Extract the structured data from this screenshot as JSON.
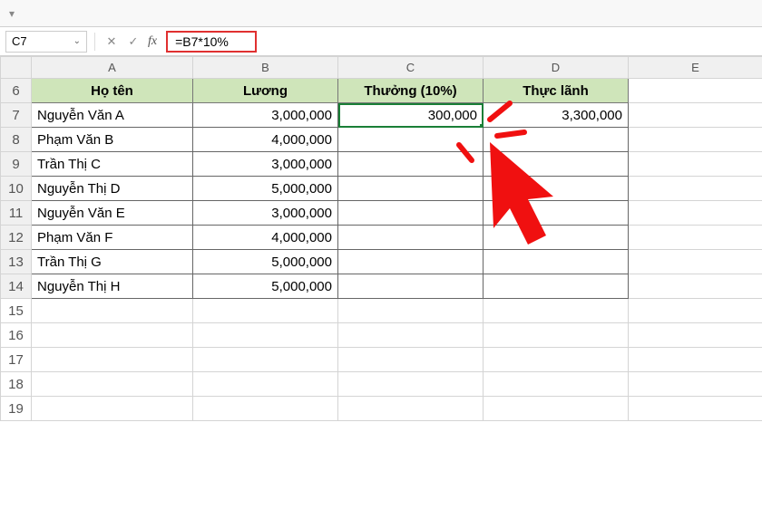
{
  "ribbon": {
    "dropdown_glyph": "▾"
  },
  "namebox": {
    "value": "C7",
    "chevron": "⌄"
  },
  "fx": {
    "cancel": "✕",
    "confirm": "✓",
    "label": "fx"
  },
  "formula": {
    "text": "=B7*10%"
  },
  "col_headers": [
    "A",
    "B",
    "C",
    "D",
    "E"
  ],
  "row_numbers": [
    "6",
    "7",
    "8",
    "9",
    "10",
    "11",
    "12",
    "13",
    "14",
    "15",
    "16",
    "17",
    "18",
    "19"
  ],
  "headers": {
    "name": "Họ tên",
    "salary": "Lương",
    "bonus": "Thưởng (10%)",
    "net": "Thực lãnh"
  },
  "rows": [
    {
      "name": "Nguyễn Văn A",
      "salary": "3,000,000",
      "bonus": "300,000",
      "net": "3,300,000"
    },
    {
      "name": "Phạm Văn B",
      "salary": "4,000,000",
      "bonus": "",
      "net": ""
    },
    {
      "name": "Trần Thị C",
      "salary": "3,000,000",
      "bonus": "",
      "net": ""
    },
    {
      "name": "Nguyễn Thị D",
      "salary": "5,000,000",
      "bonus": "",
      "net": ""
    },
    {
      "name": "Nguyễn Văn E",
      "salary": "3,000,000",
      "bonus": "",
      "net": ""
    },
    {
      "name": "Phạm Văn F",
      "salary": "4,000,000",
      "bonus": "",
      "net": ""
    },
    {
      "name": "Trần Thị G",
      "salary": "5,000,000",
      "bonus": "",
      "net": ""
    },
    {
      "name": "Nguyễn Thị H",
      "salary": "5,000,000",
      "bonus": "",
      "net": ""
    }
  ]
}
